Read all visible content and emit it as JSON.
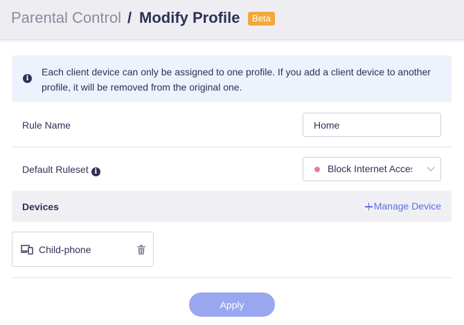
{
  "header": {
    "parent": "Parental Control",
    "separator": "/",
    "title": "Modify Profile",
    "badge": "Beta"
  },
  "info": {
    "message": "Each client device can only be assigned to one profile. If you add a client device to another profile, it will be removed from the original one."
  },
  "form": {
    "rule_name_label": "Rule Name",
    "rule_name_value": "Home",
    "ruleset_label": "Default Ruleset",
    "ruleset_value": "Block Internet Access",
    "ruleset_dot_color": "#e27d9c"
  },
  "devices": {
    "title": "Devices",
    "manage_label": "Manage Device",
    "items": [
      {
        "name": "Child-phone",
        "icon": "devices-icon"
      }
    ]
  },
  "actions": {
    "apply_label": "Apply"
  },
  "colors": {
    "accent": "#5b6ee1",
    "button": "#99a6f0",
    "badge": "#f2a93b",
    "text_dark": "#2d3154"
  }
}
